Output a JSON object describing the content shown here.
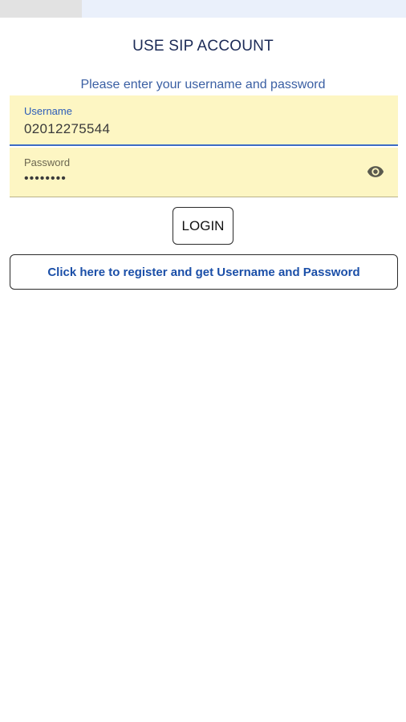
{
  "header": {
    "title": "USE SIP ACCOUNT",
    "subtitle": "Please enter your username and password"
  },
  "form": {
    "username_label": "Username",
    "username_value": "02012275544",
    "password_label": "Password",
    "password_value": "••••••••",
    "password_toggle_icon": "eye-icon"
  },
  "actions": {
    "login_label": "LOGIN",
    "register_label": "Click here to register and get Username and Password"
  },
  "colors": {
    "field_background": "#fdf6c3",
    "accent": "#3c6cc4",
    "link_text": "#1b4fa8"
  }
}
